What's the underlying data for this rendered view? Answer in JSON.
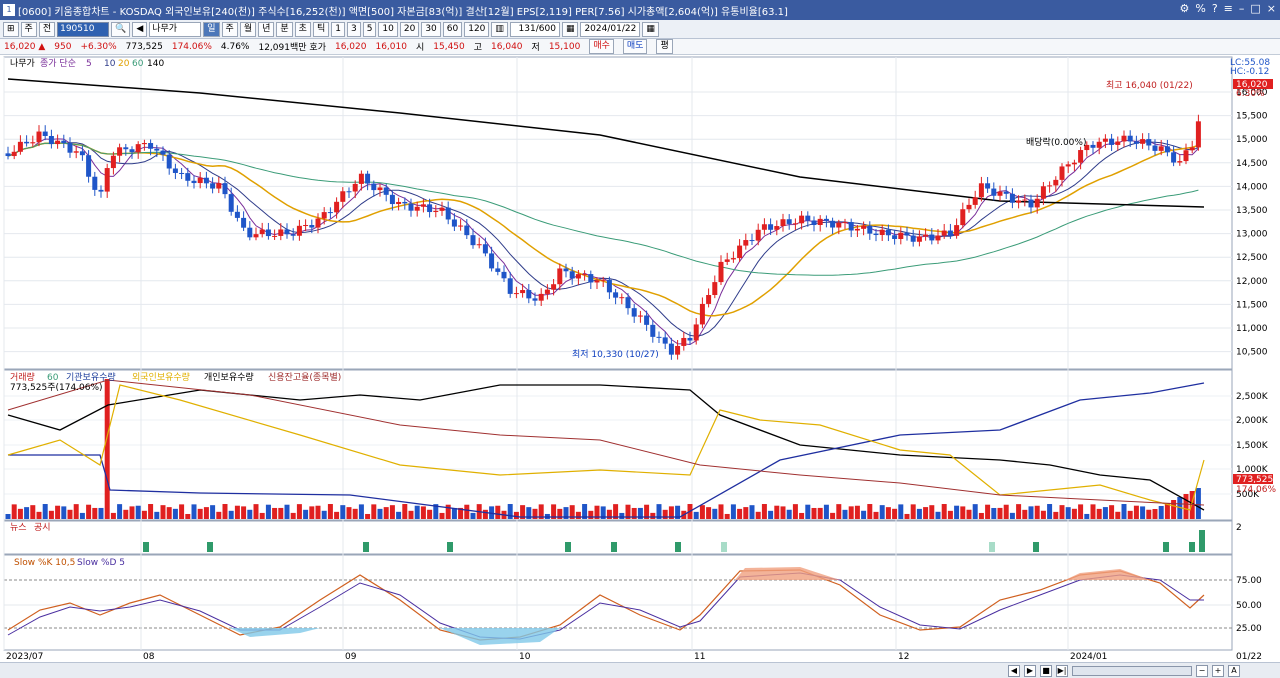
{
  "window": {
    "title": "[0600] 키움종합차트 - KOSDAQ 외국인보유[240(천)] 주식수[16,252(천)] 액면[500] 자본금[83(억)] 결산[12월] EPS[2,119] PER[7.56] 시가총액[2,604(억)] 유통비율[63.1]",
    "icon": "1"
  },
  "toolbar": {
    "period": "주",
    "prev": "전",
    "code": "190510",
    "name": "나무가",
    "tabs": [
      "일",
      "주",
      "월",
      "년",
      "분",
      "초",
      "틱"
    ],
    "active_tab": "일",
    "minutes": [
      "1",
      "3",
      "5",
      "10",
      "20",
      "30",
      "60",
      "120"
    ],
    "count": "131/600",
    "date": "2024/01/22"
  },
  "quote": {
    "price": "16,020",
    "arrow": "▲",
    "change": "950",
    "rate": "+6.30%",
    "volume": "773,525",
    "vol_rate": "174.06%",
    "turnover": "4.76%",
    "amount": "12,091백만",
    "ask_label": "호가",
    "ask": "16,020",
    "bid": "16,010",
    "open_label": "시",
    "open": "15,450",
    "high_label": "고",
    "high": "16,040",
    "low_label": "저",
    "low": "15,100",
    "buy": "매수",
    "sell": "매도",
    "flat": "평"
  },
  "main_chart": {
    "legend": [
      "나무가",
      "종가 단순",
      "5",
      "10",
      "20",
      "60",
      "140"
    ],
    "lc": "LC:55.08",
    "hc": "HC:-0.12",
    "high_note": "최고 16,040 (01/22)",
    "low_note": "최저 10,330 (10/27)",
    "div_note": "배당락(0.00%)",
    "price_tag": "16,020",
    "pct_tag": "6.30%",
    "y_labels": [
      "16,000",
      "15,500",
      "15,000",
      "14,500",
      "14,000",
      "13,500",
      "13,000",
      "12,500",
      "12,000",
      "11,500",
      "11,000",
      "10,500"
    ]
  },
  "vol_chart": {
    "legend": [
      "거래량",
      "60",
      "기관보유수량",
      "외국인보유수량",
      "개인보유수량",
      "신용잔고율(종목별)"
    ],
    "sub": "773,525주(174.06%)",
    "y_labels": [
      "2,500K",
      "2,000K",
      "1,500K",
      "1,000K",
      "500K"
    ],
    "tag": "773,525",
    "tag2": "174.06%"
  },
  "news_chart": {
    "legend": [
      "뉴스",
      "공시"
    ],
    "y_label": "2"
  },
  "stoch": {
    "legend": [
      "Slow %K 10,5",
      "Slow %D 5"
    ],
    "y_labels": [
      "75.00",
      "50.00",
      "25.00"
    ]
  },
  "x_labels": [
    "2023/07",
    "08",
    "09",
    "10",
    "11",
    "12",
    "2024/01",
    "01/22"
  ],
  "colors": {
    "up": "#e02020",
    "down": "#1f55c8",
    "ma5": "#7a2f9a",
    "ma10": "#2f3c8a",
    "ma20": "#e0a000",
    "ma60": "#3b9c78",
    "ma140": "#000000"
  },
  "chart_data": {
    "type": "candlestick",
    "title": "나무가",
    "ylabel": "",
    "xlim": [
      "2023/07",
      "2024/01/22"
    ],
    "ylim": [
      10300,
      16300
    ],
    "x": [
      "2023/07",
      "08",
      "09",
      "10",
      "11",
      "12",
      "2024/01",
      "01/22"
    ],
    "series": [
      {
        "name": "high",
        "values": [
          16040
        ]
      },
      {
        "name": "low",
        "values": [
          10330
        ]
      }
    ],
    "close": 16020
  }
}
